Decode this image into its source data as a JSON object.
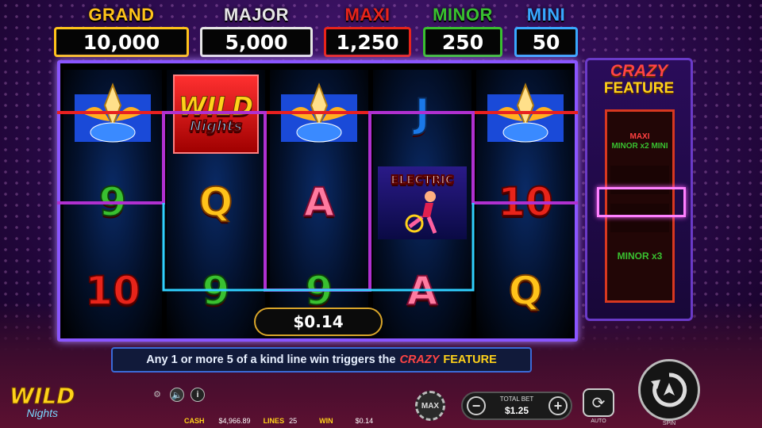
{
  "jackpots": [
    {
      "label": "GRAND",
      "value": "10,000",
      "color": "#ffc31a"
    },
    {
      "label": "MAJOR",
      "value": "5,000",
      "color": "#e6e6e6"
    },
    {
      "label": "MAXI",
      "value": "1,250",
      "color": "#e8241a"
    },
    {
      "label": "MINOR",
      "value": "250",
      "color": "#39c030"
    },
    {
      "label": "MINI",
      "value": "50",
      "color": "#38a8ff"
    }
  ],
  "reels": [
    [
      "diamond-crown",
      "9",
      "10"
    ],
    [
      "WILD",
      "Q",
      "9"
    ],
    [
      "diamond-crown",
      "A",
      "9"
    ],
    [
      "J",
      "ELECTRIC",
      "A"
    ],
    [
      "diamond-crown",
      "10",
      "Q"
    ]
  ],
  "wild_symbol": {
    "title": "WILD",
    "subtitle": "Nights"
  },
  "electric_symbol": {
    "title": "ELECTRIC"
  },
  "win_amount": "$0.14",
  "feature": {
    "title_line1": "CRAZY",
    "title_line2": "FEATURE",
    "slots": [
      {
        "line1": "MAXI",
        "line2": "MINOR x2 MINI"
      },
      {
        "line1": "MINOR x3",
        "line2": ""
      }
    ]
  },
  "message": {
    "prefix": "Any 1 or more 5 of a kind line win triggers the",
    "crazy": "CRAZY",
    "feature": "FEATURE"
  },
  "logo": {
    "title": "WILD",
    "subtitle": "Nights"
  },
  "stats": {
    "cash_label": "CASH",
    "cash": "$4,966.89",
    "lines_label": "LINES",
    "lines": "25",
    "win_label": "WIN",
    "win": "$0.14"
  },
  "controls": {
    "max_label": "MAX",
    "total_bet_label": "TOTAL BET",
    "total_bet": "$1.25",
    "auto_label": "AUTO",
    "spin_label": "SPIN"
  },
  "colors": {
    "accent": "#8a55ff",
    "payline_red": "#e82020",
    "payline_purple": "#b030d0",
    "payline_cyan": "#30d0ff"
  }
}
